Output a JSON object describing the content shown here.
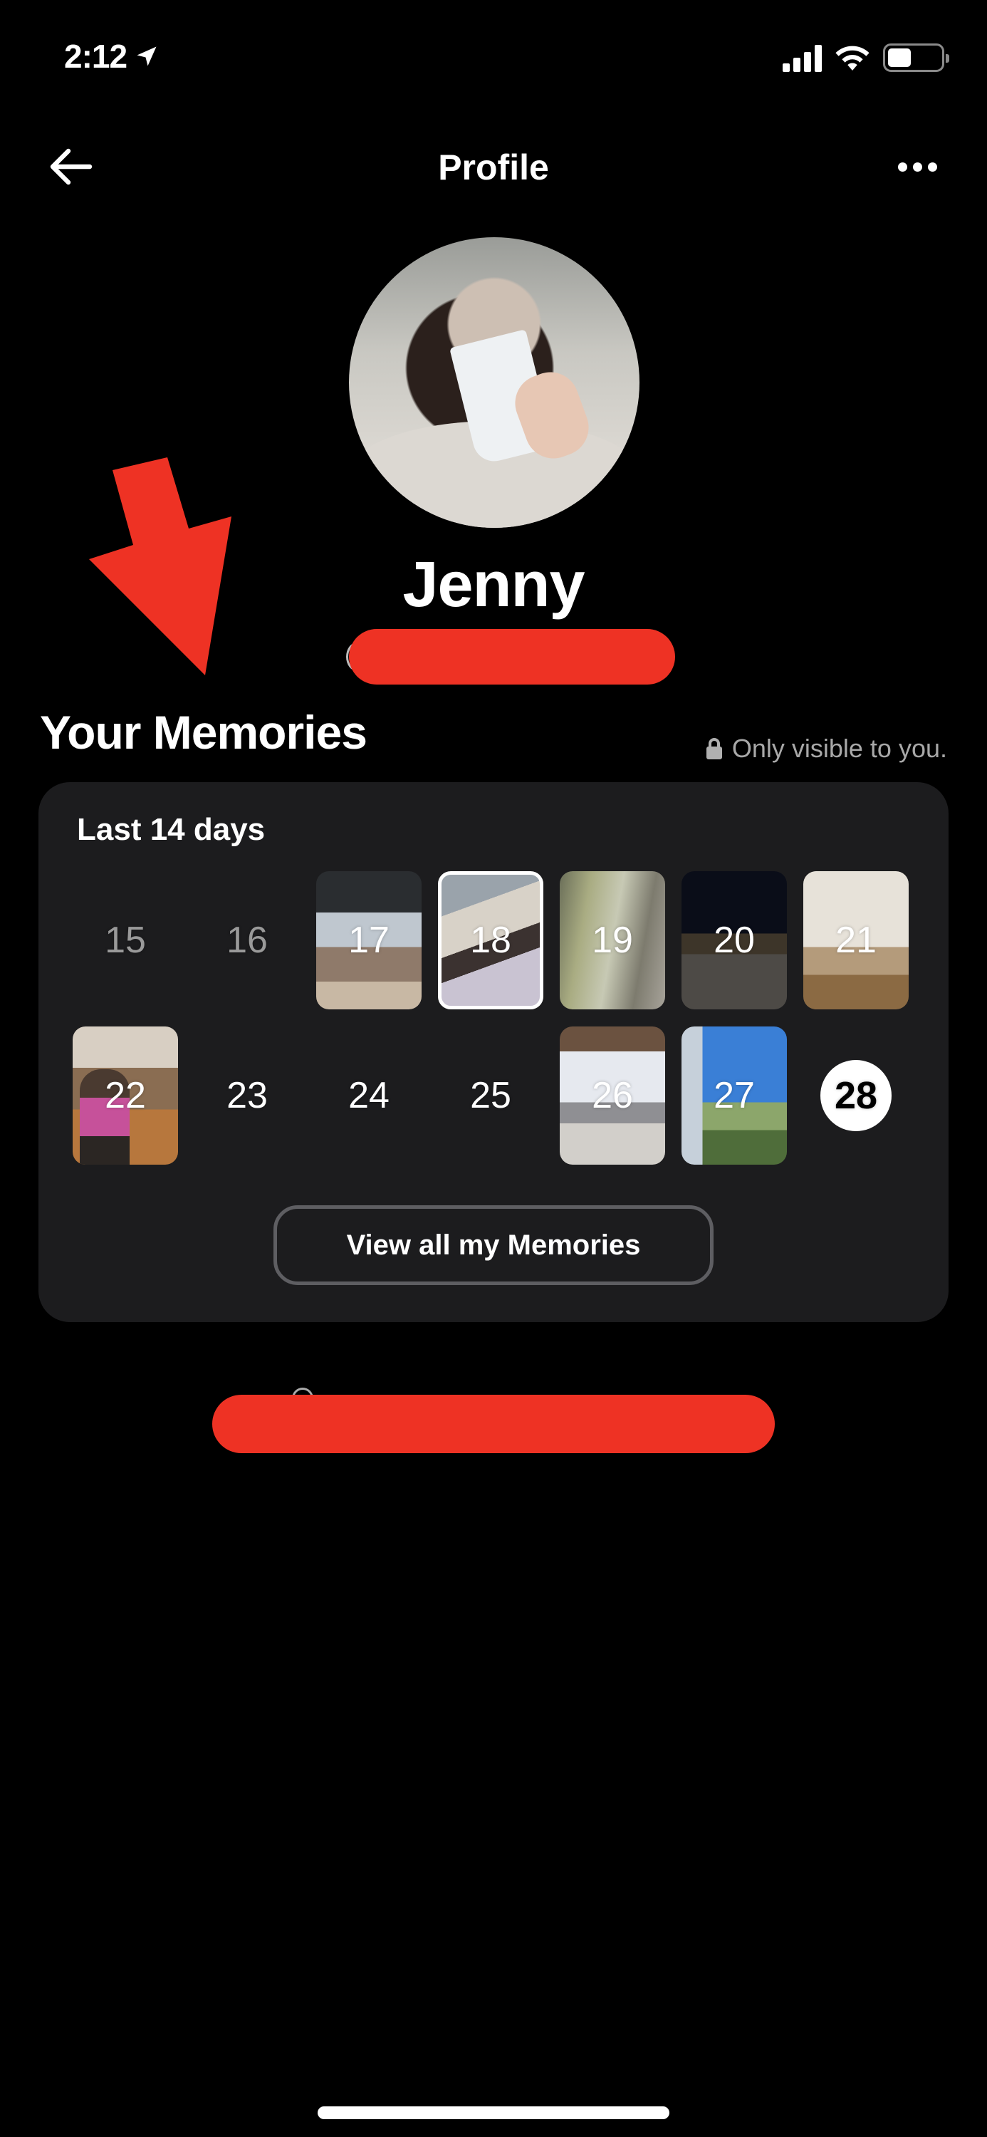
{
  "status_bar": {
    "time": "2:12",
    "location_icon": "location-arrow-icon",
    "signal_icon": "cellular-signal-icon",
    "wifi_icon": "wifi-icon",
    "battery_icon": "battery-icon",
    "battery_level_fraction": 0.45
  },
  "nav": {
    "title": "Profile",
    "back_icon": "arrow-left-icon",
    "more_icon": "ellipsis-icon"
  },
  "profile": {
    "name": "Jenny",
    "avatar_icon": "profile-photo"
  },
  "memories": {
    "title": "Your Memories",
    "visibility_note": "Only visible to you.",
    "lock_icon": "lock-icon",
    "card_label": "Last 14 days",
    "days": [
      {
        "day": "15",
        "state": "past-empty"
      },
      {
        "day": "16",
        "state": "past-empty"
      },
      {
        "day": "17",
        "state": "photo"
      },
      {
        "day": "18",
        "state": "photo-selected"
      },
      {
        "day": "19",
        "state": "photo"
      },
      {
        "day": "20",
        "state": "photo"
      },
      {
        "day": "21",
        "state": "photo"
      },
      {
        "day": "22",
        "state": "photo"
      },
      {
        "day": "23",
        "state": "empty"
      },
      {
        "day": "24",
        "state": "empty"
      },
      {
        "day": "25",
        "state": "empty"
      },
      {
        "day": "26",
        "state": "photo"
      },
      {
        "day": "27",
        "state": "photo"
      },
      {
        "day": "28",
        "state": "today"
      }
    ],
    "view_all_label": "View all my Memories"
  },
  "annotations": {
    "arrow_color": "#EE3224",
    "redaction_color": "#EE3224"
  },
  "colors": {
    "background": "#000000",
    "card": "#1C1C1E",
    "muted_text": "#A8A8A8",
    "button_border": "#5E5E62"
  }
}
